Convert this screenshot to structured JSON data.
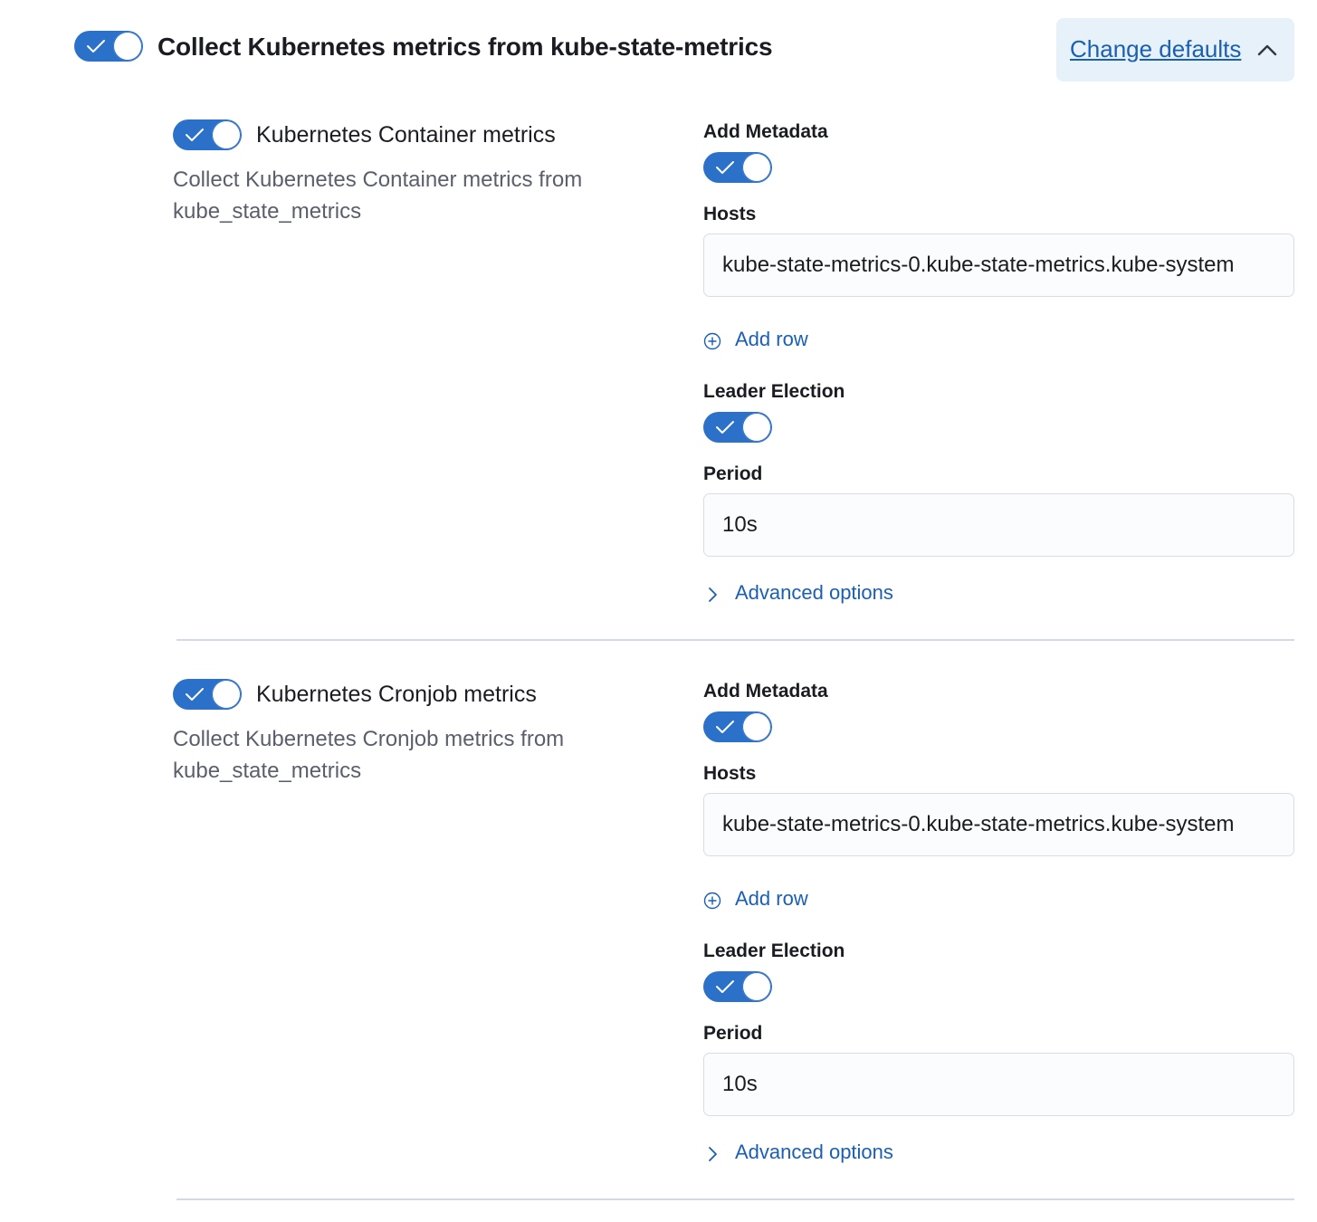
{
  "header": {
    "title": "Collect Kubernetes metrics from kube-state-metrics",
    "toggle_checked": true,
    "change_defaults_label": "Change defaults"
  },
  "streams": [
    {
      "title": "Kubernetes Container metrics",
      "description": "Collect Kubernetes Container metrics from kube_state_metrics",
      "enabled": true,
      "add_metadata_label": "Add Metadata",
      "add_metadata": true,
      "hosts_label": "Hosts",
      "hosts_value": "kube-state-metrics-0.kube-state-metrics.kube-system",
      "add_row_label": "Add row",
      "leader_election_label": "Leader Election",
      "leader_election": true,
      "period_label": "Period",
      "period_value": "10s",
      "advanced_label": "Advanced options"
    },
    {
      "title": "Kubernetes Cronjob metrics",
      "description": "Collect Kubernetes Cronjob metrics from kube_state_metrics",
      "enabled": true,
      "add_metadata_label": "Add Metadata",
      "add_metadata": true,
      "hosts_label": "Hosts",
      "hosts_value": "kube-state-metrics-0.kube-state-metrics.kube-system",
      "add_row_label": "Add row",
      "leader_election_label": "Leader Election",
      "leader_election": true,
      "period_label": "Period",
      "period_value": "10s",
      "advanced_label": "Advanced options"
    }
  ],
  "icons": {
    "toggle_check": "check-icon",
    "change_defaults": "chevron-up-icon",
    "add_row": "plus-circle-icon",
    "advanced": "chevron-right-icon"
  },
  "colors": {
    "accent": "#2b70c9",
    "link": "#1a5fb4",
    "button_bg": "#e6f1fa",
    "input_bg": "#fbfcfd",
    "border": "#d8dde5"
  }
}
